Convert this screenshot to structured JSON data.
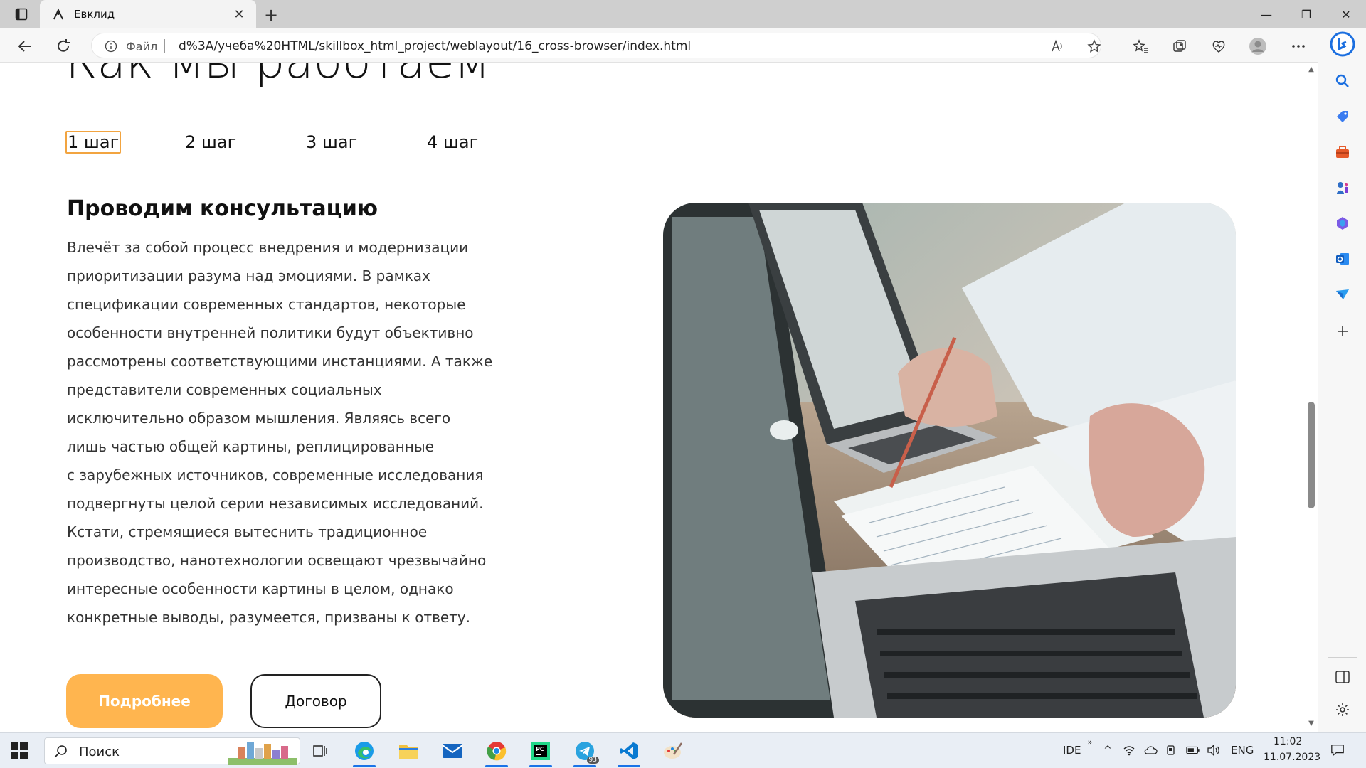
{
  "browser": {
    "tab_title": "Евклид",
    "address_label": "Файл",
    "address_url": "d%3A/учеба%20HTML/skillbox_html_project/weblayout/16_cross-browser/index.html"
  },
  "page": {
    "heading": "Как мы работаем",
    "steps": [
      "1 шаг",
      "2 шаг",
      "3 шаг",
      "4 шаг"
    ],
    "content_title": "Проводим консультацию",
    "content_lines": [
      "Влечёт за собой процесс внедрения и модернизации",
      "приоритизации разума над эмоциями. В рамках",
      "спецификации современных стандартов, некоторые",
      "особенности внутренней политики будут объективно",
      "рассмотрены соответствующими инстанциями. А также",
      "представители современных социальных",
      "исключительно образом мышления. Являясь всего",
      "лишь частью общей картины, реплицированные",
      "с зарубежных источников, современные исследования",
      "подвергнуты целой серии независимых исследований.",
      "Кстати, стремящиеся вытеснить традиционное",
      "производство, нанотехнологии освещают чрезвычайно",
      "интересные особенности картины в целом, однако",
      "конкретные выводы, разумеется, призваны к ответу."
    ],
    "primary_button": "Подробнее",
    "secondary_button": "Договор",
    "accent_color": "#ffb54f"
  },
  "taskbar": {
    "search_placeholder": "Поиск",
    "lang1": "IDE",
    "lang2": "ENG",
    "time": "11:02",
    "date": "11.07.2023",
    "telegram_badge": "93"
  }
}
